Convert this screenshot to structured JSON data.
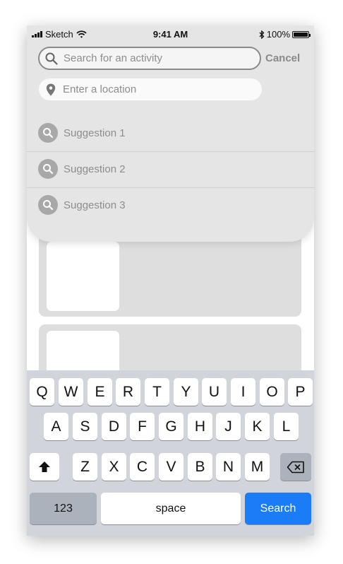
{
  "status_bar": {
    "carrier": "Sketch",
    "time": "9:41 AM",
    "battery_percent": "100%"
  },
  "search": {
    "placeholder": "Search for an activity",
    "value": "",
    "cancel_label": "Cancel"
  },
  "location": {
    "placeholder": "Enter a location",
    "value": ""
  },
  "suggestions": [
    {
      "label": "Suggestion 1"
    },
    {
      "label": "Suggestion 2"
    },
    {
      "label": "Suggestion 3"
    }
  ],
  "keyboard": {
    "row1": [
      "Q",
      "W",
      "E",
      "R",
      "T",
      "Y",
      "U",
      "I",
      "O",
      "P"
    ],
    "row2": [
      "A",
      "S",
      "D",
      "F",
      "G",
      "H",
      "J",
      "K",
      "L"
    ],
    "row3": [
      "Z",
      "X",
      "C",
      "V",
      "B",
      "N",
      "M"
    ],
    "numbers_label": "123",
    "space_label": "space",
    "search_label": "Search"
  },
  "colors": {
    "overlay_bg": "#e5e5e5",
    "keyboard_bg": "#d1d4da",
    "search_key": "#1a7df7",
    "card_bg": "#dedede"
  }
}
